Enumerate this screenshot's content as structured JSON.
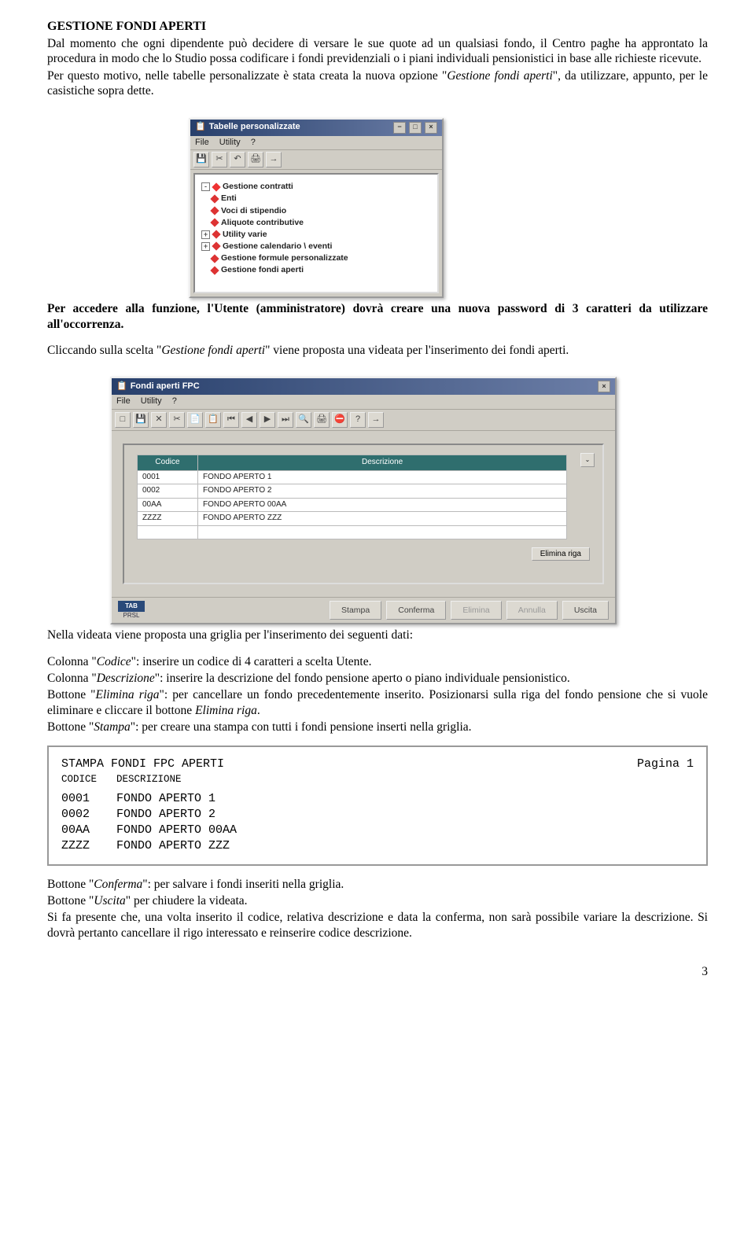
{
  "doc": {
    "title": "GESTIONE FONDI APERTI",
    "para1": "Dal momento che ogni dipendente può decidere di versare le sue quote ad un qualsiasi fondo, il Centro paghe ha approntato la procedura in modo che lo Studio possa codificare i fondi previdenziali o i piani individuali pensionistici in base alle richieste ricevute.",
    "para2a": "Per questo motivo, nelle tabelle personalizzate è stata creata la nuova opzione \"",
    "para2i": "Gestione fondi aperti",
    "para2b": "\", da utilizzare, appunto, per le casistiche sopra dette.",
    "para3": "Per accedere alla funzione, l'Utente (amministratore) dovrà creare una nuova password di 3 caratteri da utilizzare all'occorrenza.",
    "para4a": "Cliccando sulla scelta \"",
    "para4i": "Gestione fondi aperti",
    "para4b": "\" viene proposta una videata per l'inserimento dei fondi aperti.",
    "para5": "Nella videata viene proposta una griglia per l'inserimento dei seguenti dati:",
    "line_cod_a": "Colonna \"",
    "line_cod_i": "Codice",
    "line_cod_b": "\": inserire un codice di 4 caratteri a scelta Utente.",
    "line_desc_a": "Colonna \"",
    "line_desc_i": "Descrizione",
    "line_desc_b": "\": inserire la descrizione del fondo pensione aperto o piano individuale pensionistico.",
    "line_elim_a": "Bottone \"",
    "line_elim_i": "Elimina riga",
    "line_elim_b": "\": per cancellare un fondo precedentemente inserito. Posizionarsi sulla riga del fondo pensione che si vuole eliminare e cliccare il bottone ",
    "line_elim_i2": "Elimina riga",
    "line_elim_c": ".",
    "line_stampa_a": "Bottone \"",
    "line_stampa_i": "Stampa",
    "line_stampa_b": "\": per creare una stampa con tutti i fondi pensione inserti nella griglia.",
    "line_conf_a": "Bottone \"",
    "line_conf_i": "Conferma",
    "line_conf_b": "\": per salvare i fondi inseriti nella griglia.",
    "line_usc_a": "Bottone \"",
    "line_usc_i": "Uscita",
    "line_usc_b": "\" per chiudere la videata.",
    "para6": "Si fa presente che, una volta inserito il codice, relativa descrizione e data la conferma, non sarà possibile variare la descrizione. Si dovrà pertanto cancellare il rigo interessato e reinserire codice descrizione.",
    "page": "3"
  },
  "win1": {
    "title": "Tabelle personalizzate",
    "menu_file": "File",
    "menu_utility": "Utility",
    "menu_help": "?",
    "items": [
      {
        "exp": "-",
        "label": "Gestione contratti",
        "sel": true
      },
      {
        "exp": "",
        "label": "Enti"
      },
      {
        "exp": "",
        "label": "Voci di stipendio"
      },
      {
        "exp": "",
        "label": "Aliquote contributive"
      },
      {
        "exp": "+",
        "label": "Utility varie"
      },
      {
        "exp": "+",
        "label": "Gestione calendario \\ eventi"
      },
      {
        "exp": "",
        "label": "Gestione formule personalizzate"
      },
      {
        "exp": "",
        "label": "Gestione fondi aperti"
      }
    ]
  },
  "win2": {
    "title": "Fondi aperti FPC",
    "menu_file": "File",
    "menu_utility": "Utility",
    "menu_help": "?",
    "th_cod": "Codice",
    "th_desc": "Descrizione",
    "rows": [
      {
        "cod": "0001",
        "desc": "FONDO APERTO 1"
      },
      {
        "cod": "0002",
        "desc": "FONDO APERTO 2"
      },
      {
        "cod": "00AA",
        "desc": "FONDO APERTO 00AA"
      },
      {
        "cod": "ZZZZ",
        "desc": "FONDO APERTO ZZZ"
      }
    ],
    "btn_elim": "Elimina riga",
    "btn_stampa": "Stampa",
    "btn_conf": "Conferma",
    "btn_elimina": "Elimina",
    "btn_annulla": "Annulla",
    "btn_uscita": "Uscita",
    "logo_top": "TAB",
    "logo_bot": "PRSL"
  },
  "print": {
    "title": "STAMPA FONDI FPC APERTI",
    "page": "Pagina 1",
    "h1": "CODICE",
    "h2": "DESCRIZIONE",
    "rows": [
      {
        "cod": "0001",
        "desc": "FONDO APERTO 1"
      },
      {
        "cod": "0002",
        "desc": "FONDO APERTO 2"
      },
      {
        "cod": "00AA",
        "desc": "FONDO APERTO 00AA"
      },
      {
        "cod": "ZZZZ",
        "desc": "FONDO APERTO ZZZ"
      }
    ]
  }
}
